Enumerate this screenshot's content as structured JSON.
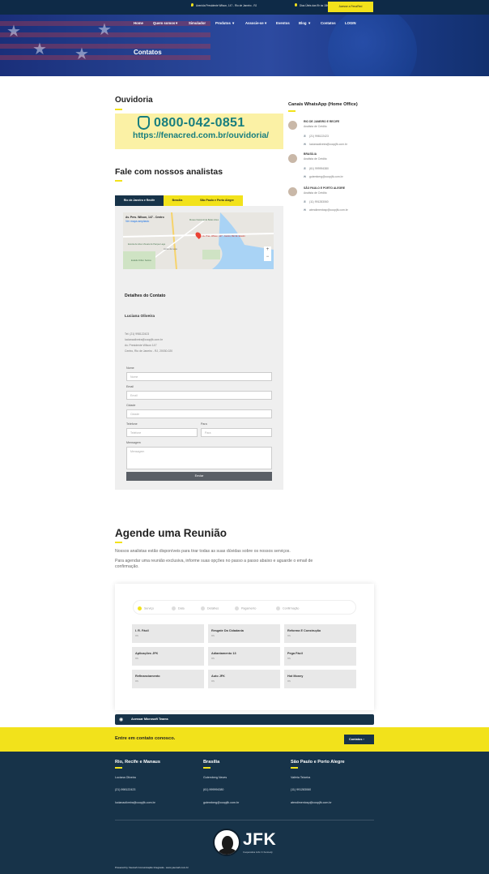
{
  "topbar": {
    "address": "Avenida Presidente Wilson, 147 - Rio de Janeiro - RJ",
    "hours": "Dias Úteis das 9h às 18h",
    "cta_label": "Acesse a FenaRed"
  },
  "nav": {
    "items": [
      "Home",
      "Quem somos",
      "Simulador",
      "Produtos",
      "Associe-se",
      "Eventos",
      "Blog",
      "Contatos",
      "LOGIN"
    ]
  },
  "hero": {
    "title": "Contatos"
  },
  "ouvidoria": {
    "heading": "Ouvidoria",
    "phone": "0800-042-0851",
    "url": "https://fenacred.com.br/ouvidoria/"
  },
  "analysts": {
    "heading": "Fale com nossos analistas",
    "tabs": [
      "Rio de Janeiro e Recife",
      "Brasília",
      "São Paulo e Porto Alegre"
    ],
    "map": {
      "place": "Av. Pres. Wilson, 147 - Centro",
      "link": "Ver mapa ampliado",
      "pin_label": "Av. Pres. Wilson, 147 - Centro, Rio de Janeiro",
      "labels": [
        "Museu Nacional de Belas Artes",
        "Escola de Artes Visuais do Parque Lage",
        "Arcos da Lapa",
        "Estádio Nilton Santos"
      ]
    },
    "details_heading": "Detalhes do Contato",
    "contact_name": "Luciana Oliveira",
    "contact_lines": [
      "Tel: (21) 998122423",
      "lucianaoliveira@coopjfk.com.br",
      "Av. Presidente Wilson 147",
      "Centro, Rio de Janeiro - RJ, 20030-020"
    ]
  },
  "form": {
    "name_label": "Nome",
    "name_ph": "Nome",
    "email_label": "Email",
    "email_ph": "Email",
    "city_label": "Cidade",
    "city_ph": "Cidade",
    "phone_label": "Telefone",
    "phone_ph": "Telefone",
    "role_label": "Para",
    "role_ph": "Para",
    "msg_label": "Mensagem",
    "msg_ph": "Mensagem",
    "submit": "Enviar"
  },
  "whatsapp": {
    "heading": "Canais WhatsApp (Home Office)",
    "contacts": [
      {
        "region": "RIO DE JANEIRO E RECIFE",
        "role": "Analista de Crédito",
        "phone": "(21) 998122423",
        "email": "lucianaoliveira@coopjfk.com.br"
      },
      {
        "region": "BRASÍLIA",
        "role": "Analista de Crédito",
        "phone": "(61) 999994380",
        "email": "gutemberg@coopjfk.com.br"
      },
      {
        "region": "SÃO PAULO E PORTO ALEGRE",
        "role": "Analista de Crédito",
        "phone": "(11) 991283060",
        "email": "atendimentosp@coopjfk.com.br"
      }
    ]
  },
  "meeting": {
    "heading": "Agende uma Reunião",
    "p1": "Nossos analistas estão disponíveis para tirar todas as suas dúvidas sobre os nossos serviços.",
    "p2a": "Para agendar uma reunião exclusiva, informe suas opções no passo a passo abaixo e aguarde o email de",
    "p2b": "confirmação.",
    "steps": [
      "Serviço",
      "Data",
      "Detalhes",
      "Pagamento",
      "Confirmação"
    ],
    "services": [
      {
        "name": "I. R. Fácil",
        "sub": "R$"
      },
      {
        "name": "Resgate Da Cidadania",
        "sub": "R$"
      },
      {
        "name": "Reforma E Construção",
        "sub": "R$"
      },
      {
        "name": "Aplicações JFK",
        "sub": "R$"
      },
      {
        "name": "Adiantamento 13",
        "sub": "R$"
      },
      {
        "name": "Pega Fácil",
        "sub": "R$"
      },
      {
        "name": "Refinanciamento",
        "sub": "R$"
      },
      {
        "name": "Auto JFK",
        "sub": "R$"
      },
      {
        "name": "Hot Money",
        "sub": "R$"
      }
    ],
    "teams_label": "Acessar Microsoft Teams"
  },
  "contact_band": {
    "text": "Entre em contato conosco.",
    "button": "Contatos"
  },
  "footer": {
    "cols": [
      {
        "title": "Rio, Recife e Manaus",
        "name": "Luciana Oliveira",
        "phone": "(21) 998122423",
        "email": "lucianaoliveira@coopjfk.com.br"
      },
      {
        "title": "Brasília",
        "name": "Gutemberg Neves",
        "phone": "(61) 999994380",
        "email": "gutemberg@coopjfk.com.br"
      },
      {
        "title": "São Paulo e Porto Alegre",
        "name": "Valéria Teixeira",
        "phone": "(11) 991283060",
        "email": "atendimentosp@coopjfk.com.br"
      }
    ],
    "logo_text": "JFK",
    "logo_sub": "Cooperativa John F. Kennedy",
    "credit": "Powered by Yaemah Comunicação Integrada - www.yaemah.com.br"
  },
  "colors": {
    "accent": "#f2e21b",
    "navy": "#173349",
    "teal": "#187e7e"
  }
}
